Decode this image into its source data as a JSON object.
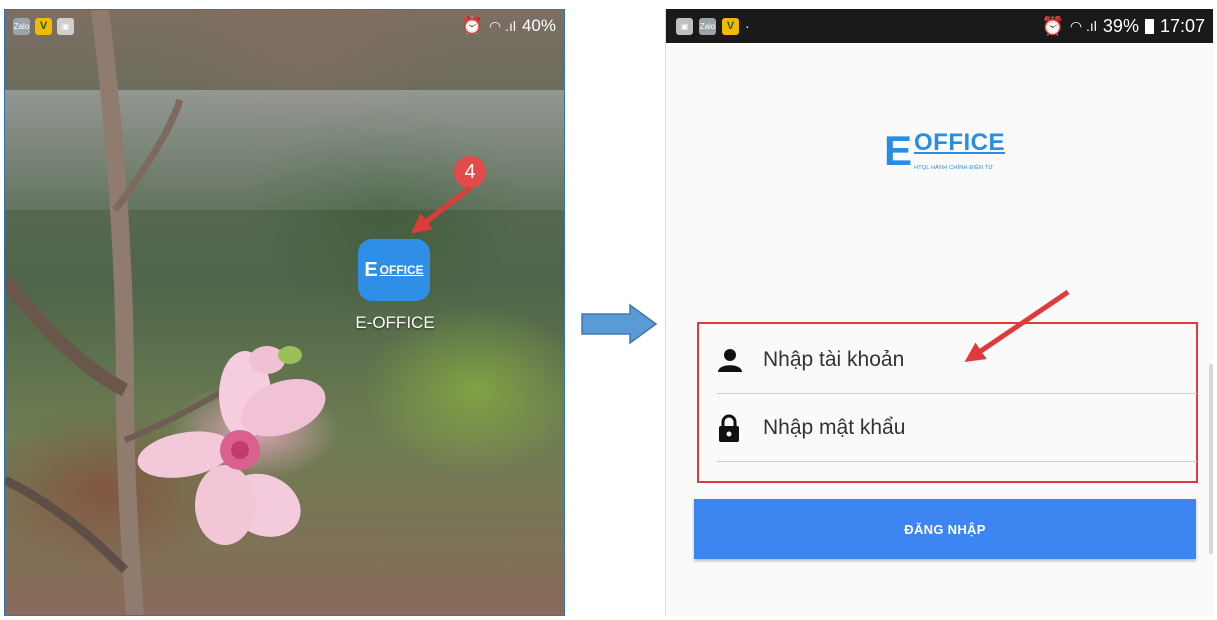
{
  "left_screen": {
    "status": {
      "battery": "40%"
    },
    "app": {
      "icon_e": "E",
      "icon_text": "OFFICE",
      "label": "E-OFFICE"
    },
    "step_badge": "4"
  },
  "right_screen": {
    "status": {
      "battery": "39%",
      "time": "17:07"
    },
    "logo": {
      "letter": "E",
      "name": "OFFICE",
      "tagline": "HTQL HÀNH CHÍNH ĐIỆN TỬ"
    },
    "username": {
      "placeholder": "Nhập tài khoản",
      "icon": "person-icon"
    },
    "password": {
      "placeholder": "Nhập mật khẩu",
      "icon": "lock-icon"
    },
    "login_button": "ĐĂNG NHẬP"
  },
  "colors": {
    "accent_blue": "#2a8de4",
    "button_blue": "#3d85f0",
    "highlight_red": "#e03b3b",
    "badge_red": "#e34a4a"
  }
}
